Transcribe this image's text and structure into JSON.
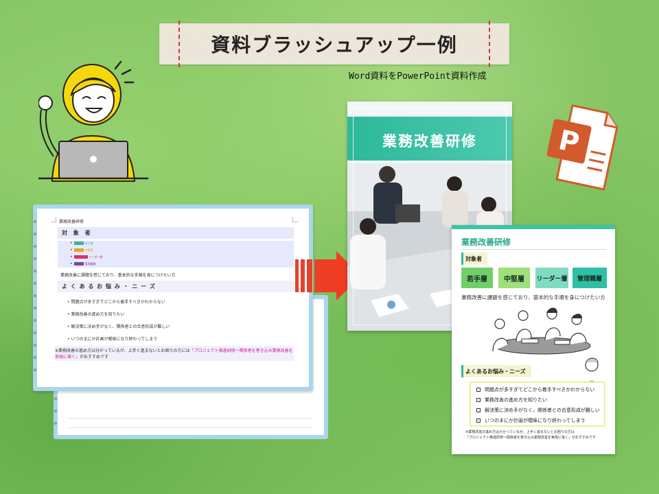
{
  "banner": {
    "title": "資料ブラッシュアップ一例"
  },
  "subtitle": "Word資料をPowerPoint資料作成",
  "word_doc": {
    "heading": "業務改善研修",
    "section1": "対 象 者",
    "tags": [
      {
        "label": "若手層",
        "color": "#3ab59a"
      },
      {
        "label": "中堅層",
        "color": "#e8a21f"
      },
      {
        "label": "リーダー層",
        "color": "#d9316b"
      },
      {
        "label": "管理職層",
        "color": "#7a4c8c"
      }
    ],
    "intro": "業務改善に課題を感じており、基本的な手順を身につけたい方",
    "section2": "よ く あ る お 悩 み ・ ニ ー ズ",
    "bullets": [
      "問題点が多すぎてどこから着手すべきかわからない",
      "業務改善の進め方を知りたい",
      "解決策に決め手がなく、関係者との合意形成が難しい",
      "いつのまにか計画が曖昧になり終わってしまう"
    ],
    "note_prefix": "※業務改善の進め方は分かっているが、上手く進まないとお困りの方には",
    "note_link": "「プロジェクト推進研修～関係者を巻き込み業務改善を実現に導く」",
    "note_suffix": "がおすすめです"
  },
  "cover_slide": {
    "title": "業務改善研修"
  },
  "content_slide": {
    "title": "業務改善研修",
    "target_label": "対象者",
    "targets": [
      {
        "label": "若手層",
        "color": "#6fd06a"
      },
      {
        "label": "中堅層",
        "color": "#9ee07a"
      },
      {
        "label": "リーダー層",
        "color": "#7fdcc2"
      },
      {
        "label": "管理職層",
        "color": "#2fbfa5"
      }
    ],
    "description": "業務改善に課題を感じており、基本的な手順を身につけたい方",
    "needs_label": "よくあるお悩み・ニーズ",
    "needs": [
      "問題点が多すぎてどこから着手すべきかわからない",
      "業務改善の進め方を知りたい",
      "解決策に決め手がなく、関係者との合意形成が難しい",
      "いつのまにか計画が曖昧になり終わってしまう"
    ],
    "footnote_line1": "※業務改善の進め方は分かっているが、上手く進まないとお困りの方は",
    "footnote_line2": "「プロジェクト推進研修～関係者を巻き込み業務改善を実現に導く」がおすすめです"
  },
  "ppt_icon": {
    "letter": "P",
    "color": "#d35a2a"
  }
}
